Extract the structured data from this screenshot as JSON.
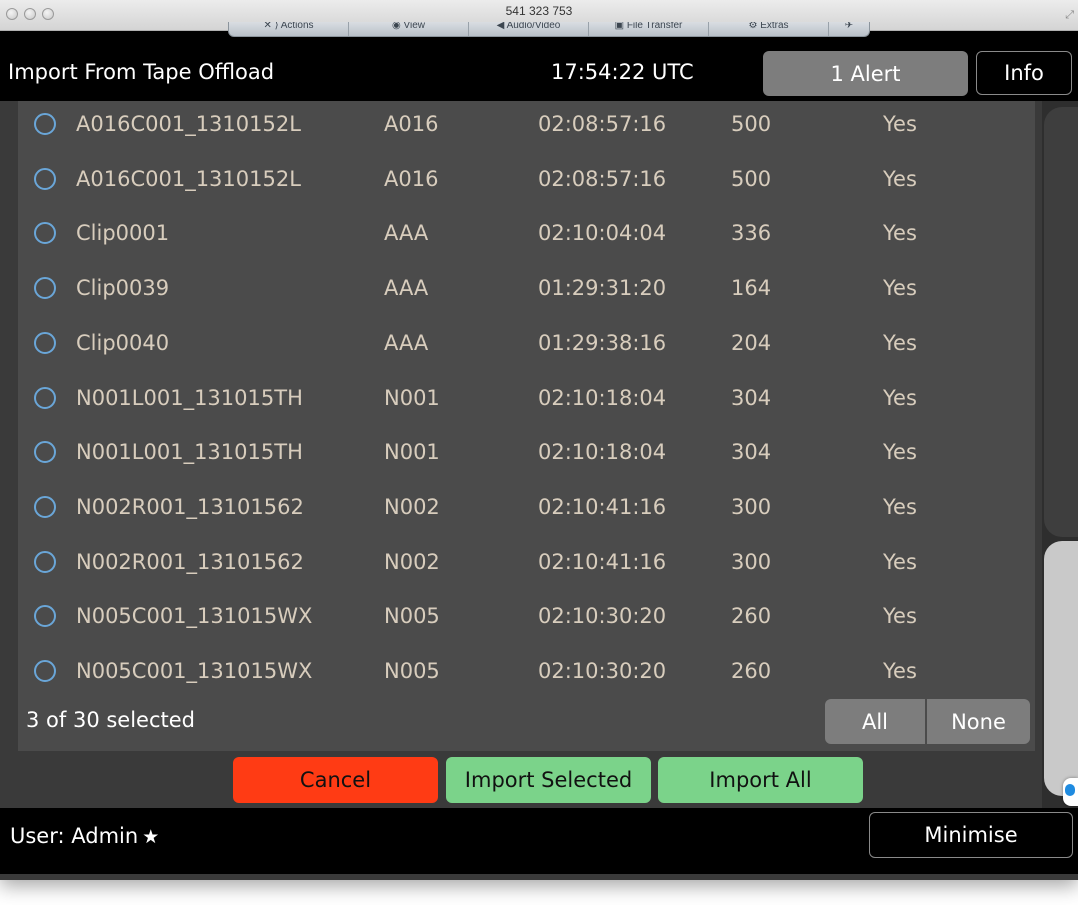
{
  "window": {
    "title": "541 323 753"
  },
  "toolbar": {
    "items": [
      "✕ ⟩ Actions",
      "◉ View",
      "◀ Audio/Video",
      "▣ File Transfer",
      "⚙ Extras",
      "✈"
    ]
  },
  "header": {
    "title": "Import From Tape Offload",
    "clock": "17:54:22 UTC",
    "alert_label": "1 Alert",
    "info_label": "Info"
  },
  "clips": [
    {
      "name": "A016C001_1310152L",
      "reel": "A016",
      "timecode": "02:08:57:16",
      "duration": "500",
      "flag": "Yes"
    },
    {
      "name": "A016C001_1310152L",
      "reel": "A016",
      "timecode": "02:08:57:16",
      "duration": "500",
      "flag": "Yes"
    },
    {
      "name": "Clip0001",
      "reel": "AAA",
      "timecode": "02:10:04:04",
      "duration": "336",
      "flag": "Yes"
    },
    {
      "name": "Clip0039",
      "reel": "AAA",
      "timecode": "01:29:31:20",
      "duration": "164",
      "flag": "Yes"
    },
    {
      "name": "Clip0040",
      "reel": "AAA",
      "timecode": "01:29:38:16",
      "duration": "204",
      "flag": "Yes"
    },
    {
      "name": "N001L001_131015TH",
      "reel": "N001",
      "timecode": "02:10:18:04",
      "duration": "304",
      "flag": "Yes"
    },
    {
      "name": "N001L001_131015TH",
      "reel": "N001",
      "timecode": "02:10:18:04",
      "duration": "304",
      "flag": "Yes"
    },
    {
      "name": "N002R001_13101562",
      "reel": "N002",
      "timecode": "02:10:41:16",
      "duration": "300",
      "flag": "Yes"
    },
    {
      "name": "N002R001_13101562",
      "reel": "N002",
      "timecode": "02:10:41:16",
      "duration": "300",
      "flag": "Yes"
    },
    {
      "name": "N005C001_131015WX",
      "reel": "N005",
      "timecode": "02:10:30:20",
      "duration": "260",
      "flag": "Yes"
    },
    {
      "name": "N005C001_131015WX",
      "reel": "N005",
      "timecode": "02:10:30:20",
      "duration": "260",
      "flag": "Yes"
    }
  ],
  "selection": {
    "count_text": "3 of 30 selected",
    "all_label": "All",
    "none_label": "None"
  },
  "actions": {
    "cancel_label": "Cancel",
    "import_selected_label": "Import Selected",
    "import_all_label": "Import All"
  },
  "footer": {
    "user_label": "User: Admin",
    "star_icon": "★",
    "minimise_label": "Minimise"
  },
  "colors": {
    "cancel": "#ff3b14",
    "import": "#7bd38a",
    "radio": "#6aa6d8",
    "row_text": "#d8cdbd"
  }
}
